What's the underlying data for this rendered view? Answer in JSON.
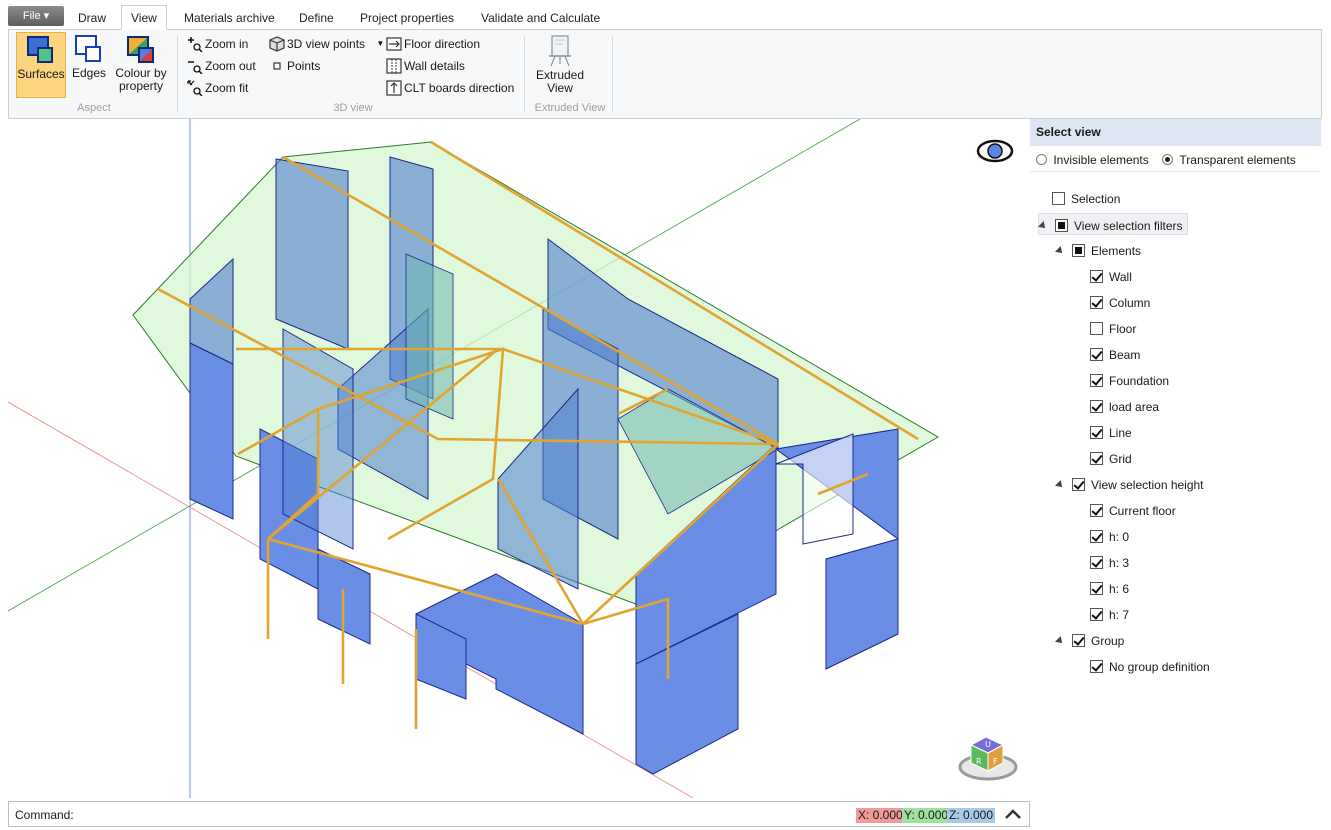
{
  "file_menu": {
    "label": "File ▾"
  },
  "tabs": [
    {
      "label": "Draw"
    },
    {
      "label": "View"
    },
    {
      "label": "Materials archive"
    },
    {
      "label": "Define"
    },
    {
      "label": "Project properties"
    },
    {
      "label": "Validate and Calculate"
    }
  ],
  "active_tab": "View",
  "ribbon": {
    "aspect": {
      "group_label": "Aspect",
      "surfaces": "Surfaces",
      "edges": "Edges",
      "colour_by_line1": "Colour by",
      "colour_by_line2": "property"
    },
    "view3d": {
      "group_label": "3D view",
      "zoom_in": "Zoom in",
      "zoom_out": "Zoom out",
      "zoom_fit": "Zoom fit",
      "view_points": "3D view points",
      "points": "Points",
      "floor_direction": "Floor direction",
      "wall_details": "Wall details",
      "clt_boards_direction": "CLT boards direction"
    },
    "extruded": {
      "group_label": "Extruded View",
      "button_line1": "Extruded",
      "button_line2": "View"
    }
  },
  "panel": {
    "title": "Select view",
    "radio_invisible": "Invisible elements",
    "radio_transparent": "Transparent elements",
    "radio_selected": "Transparent elements",
    "tree": [
      {
        "label": "Selection",
        "state": "unchecked",
        "level": 0,
        "expander": false
      },
      {
        "label": "View selection filters",
        "state": "partial",
        "level": 0,
        "expander": true
      },
      {
        "label": "Elements",
        "state": "partial",
        "level": 1,
        "expander": true
      },
      {
        "label": "Wall",
        "state": "checked",
        "level": 2,
        "expander": false
      },
      {
        "label": "Column",
        "state": "checked",
        "level": 2,
        "expander": false
      },
      {
        "label": "Floor",
        "state": "unchecked",
        "level": 2,
        "expander": false
      },
      {
        "label": "Beam",
        "state": "checked",
        "level": 2,
        "expander": false
      },
      {
        "label": "Foundation",
        "state": "checked",
        "level": 2,
        "expander": false
      },
      {
        "label": "load area",
        "state": "checked",
        "level": 2,
        "expander": false
      },
      {
        "label": "Line",
        "state": "checked",
        "level": 2,
        "expander": false
      },
      {
        "label": "Grid",
        "state": "checked",
        "level": 2,
        "expander": false
      },
      {
        "label": "View selection height",
        "state": "checked",
        "level": 1,
        "expander": true
      },
      {
        "label": "Current floor",
        "state": "checked",
        "level": 2,
        "expander": false
      },
      {
        "label": "h: 0",
        "state": "checked",
        "level": 2,
        "expander": false
      },
      {
        "label": "h: 3",
        "state": "checked",
        "level": 2,
        "expander": false
      },
      {
        "label": "h: 6",
        "state": "checked",
        "level": 2,
        "expander": false
      },
      {
        "label": "h: 7",
        "state": "checked",
        "level": 2,
        "expander": false
      },
      {
        "label": "Group",
        "state": "checked",
        "level": 1,
        "expander": true
      },
      {
        "label": "No group definition",
        "state": "checked",
        "level": 2,
        "expander": false
      }
    ]
  },
  "command_bar": {
    "label": "Command:",
    "x": "X: 0.000",
    "y": "Y: 0.000",
    "z": "Z: 0.000"
  },
  "colors": {
    "wall_blue": "#6a8ee6",
    "roof_green": "#d6f5d0",
    "beam_orange": "#e0a530",
    "active_button": "#fcd57e"
  },
  "view_cube_faces": [
    "U",
    "R",
    "F"
  ]
}
